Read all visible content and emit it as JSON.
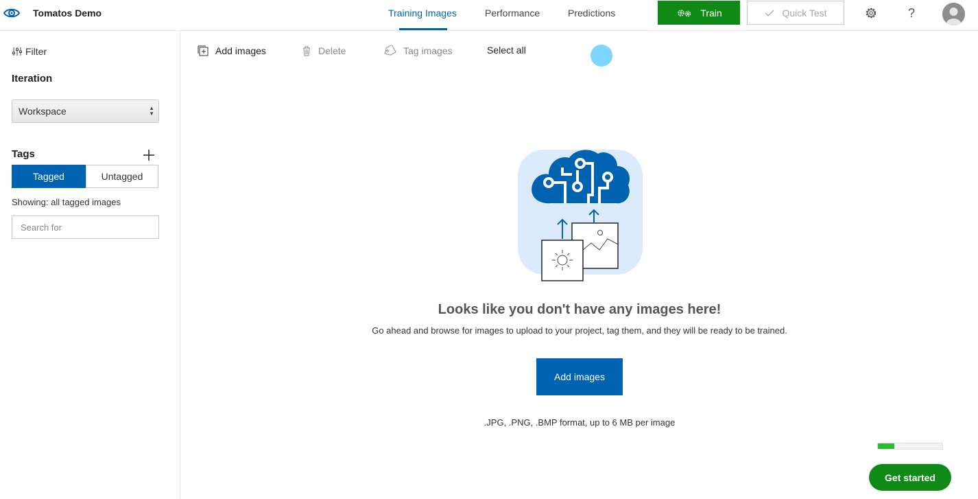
{
  "app": {
    "title": "Tomatos Demo"
  },
  "nav": {
    "tabs": [
      {
        "label": "Training Images",
        "active": true
      },
      {
        "label": "Performance",
        "active": false
      },
      {
        "label": "Predictions",
        "active": false
      }
    ]
  },
  "header": {
    "train_label": "Train",
    "quick_test_label": "Quick Test",
    "settings_icon": "gear-icon",
    "help_label": "?"
  },
  "sidebar": {
    "filter_label": "Filter",
    "iteration_label": "Iteration",
    "iteration_value": "Workspace",
    "tags_label": "Tags",
    "tagged_label": "Tagged",
    "untagged_label": "Untagged",
    "showing_text": "Showing: all tagged images",
    "search_placeholder": "Search for"
  },
  "toolbar": {
    "add_images_label": "Add images",
    "delete_label": "Delete",
    "tag_images_label": "Tag images",
    "select_all_label": "Select all"
  },
  "empty_state": {
    "title": "Looks like you don't have any images here!",
    "subtitle": "Go ahead and browse for images to upload to your project, tag them, and they will be ready to be trained.",
    "button_label": "Add images",
    "formats_text": ".JPG, .PNG, .BMP format, up to 6 MB per image"
  },
  "onboarding": {
    "progress_fraction": 0.25,
    "button_label": "Get started"
  },
  "colors": {
    "accent_blue": "#0063b1",
    "train_green": "#0f8a16",
    "progress_green": "#2ab92f",
    "cursor_dot": "#7dd6ff"
  }
}
